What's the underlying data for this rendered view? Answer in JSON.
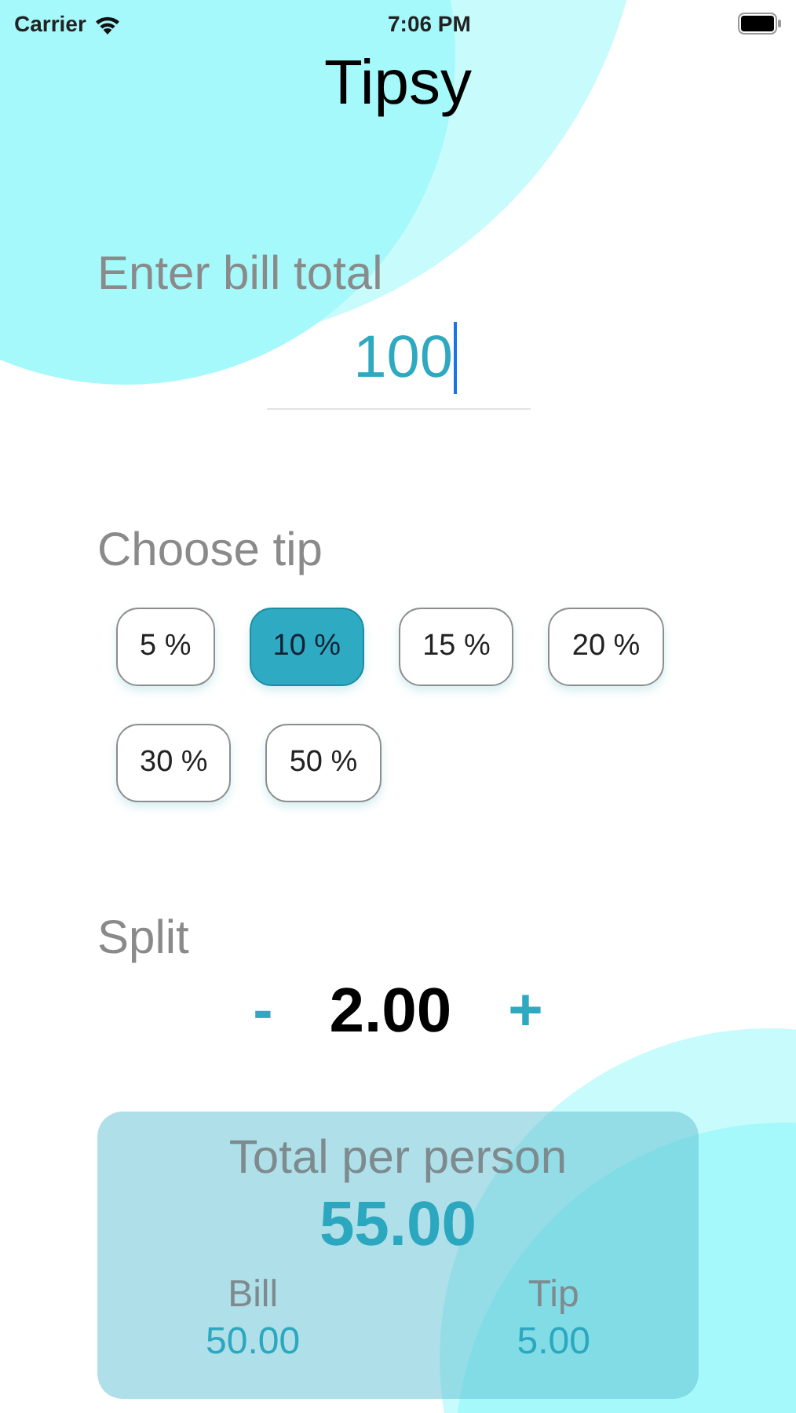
{
  "status_bar": {
    "carrier": "Carrier",
    "time": "7:06 PM"
  },
  "title": "Tipsy",
  "bill": {
    "label": "Enter bill total",
    "value": "100",
    "focused": true
  },
  "tip": {
    "label": "Choose tip",
    "options": [
      {
        "label": "5 %",
        "selected": false
      },
      {
        "label": "10 %",
        "selected": true
      },
      {
        "label": "15 %",
        "selected": false
      },
      {
        "label": "20 %",
        "selected": false
      },
      {
        "label": "30 %",
        "selected": false
      },
      {
        "label": "50 %",
        "selected": false
      }
    ]
  },
  "split": {
    "label": "Split",
    "decrement": "-",
    "value": "2.00",
    "increment": "+"
  },
  "result": {
    "label": "Total per person",
    "total": "55.00",
    "bill_label": "Bill",
    "bill_value": "50.00",
    "tip_label": "Tip",
    "tip_value": "5.00"
  }
}
